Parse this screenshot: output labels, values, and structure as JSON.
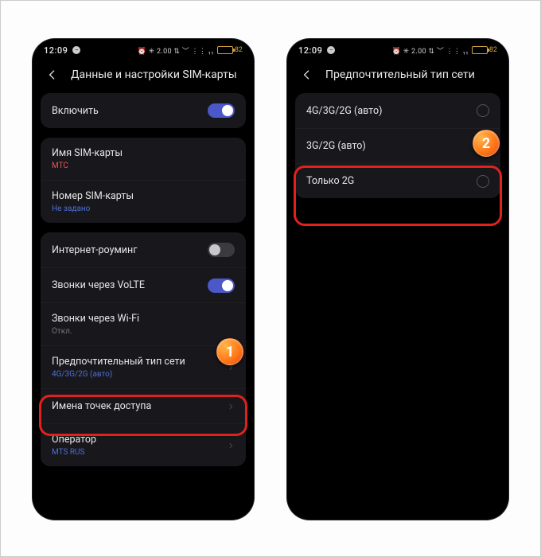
{
  "status": {
    "time": "12:09",
    "indicators": "⏰ ✳ 2.00 ⇅ ﹀ ⋮⋮ ₁₁",
    "battery_pct": "82"
  },
  "left": {
    "title": "Данные и настройки SIM-карты",
    "enable_label": "Включить",
    "sim_name_label": "Имя SIM-карты",
    "sim_name_value": "МТС",
    "sim_number_label": "Номер SIM-карты",
    "sim_number_value": "Не задано",
    "roaming_label": "Интернет-роуминг",
    "volte_label": "Звонки через VoLTE",
    "wifi_calls_label": "Звонки через Wi-Fi",
    "wifi_calls_value": "Откл.",
    "net_type_label": "Предпочтительный тип сети",
    "net_type_value": "4G/3G/2G (авто)",
    "apn_label": "Имена точек доступа",
    "operator_label": "Оператор",
    "operator_value": "MTS RUS"
  },
  "right": {
    "title": "Предпочтительный тип сети",
    "opt1": "4G/3G/2G (авто)",
    "opt2": "3G/2G (авто)",
    "opt3": "Только 2G"
  },
  "badges": {
    "one": "1",
    "two": "2"
  }
}
